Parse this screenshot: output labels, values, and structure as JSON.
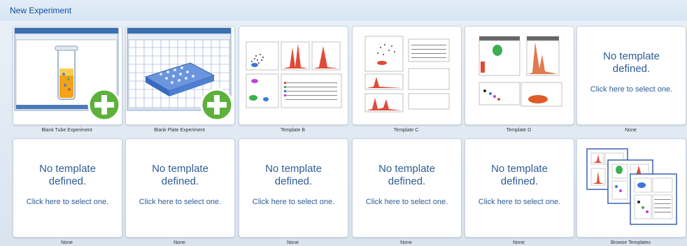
{
  "header": {
    "title": "New Experiment"
  },
  "row1": [
    {
      "caption": "Blank Tube Experiment"
    },
    {
      "caption": "Blank Plate Experiment"
    },
    {
      "caption": "Template B"
    },
    {
      "caption": "Template C"
    },
    {
      "caption": "Template D"
    },
    {
      "caption": "None",
      "message": "No template defined.",
      "link": "Click here to select one."
    }
  ],
  "row2": [
    {
      "caption": "None",
      "message": "No template defined.",
      "link": "Click here to select one."
    },
    {
      "caption": "None",
      "message": "No template defined.",
      "link": "Click here to select one."
    },
    {
      "caption": "None",
      "message": "No template defined.",
      "link": "Click here to select one."
    },
    {
      "caption": "None",
      "message": "No template defined.",
      "link": "Click here to select one."
    },
    {
      "caption": "None",
      "message": "No template defined.",
      "link": "Click here to select one."
    },
    {
      "caption": "Browse Templates"
    }
  ],
  "colors": {
    "title": "#0b4fa3",
    "link_text": "#2e5c96",
    "add_green": "#5db13b",
    "histogram_red": "#e04a3a"
  }
}
